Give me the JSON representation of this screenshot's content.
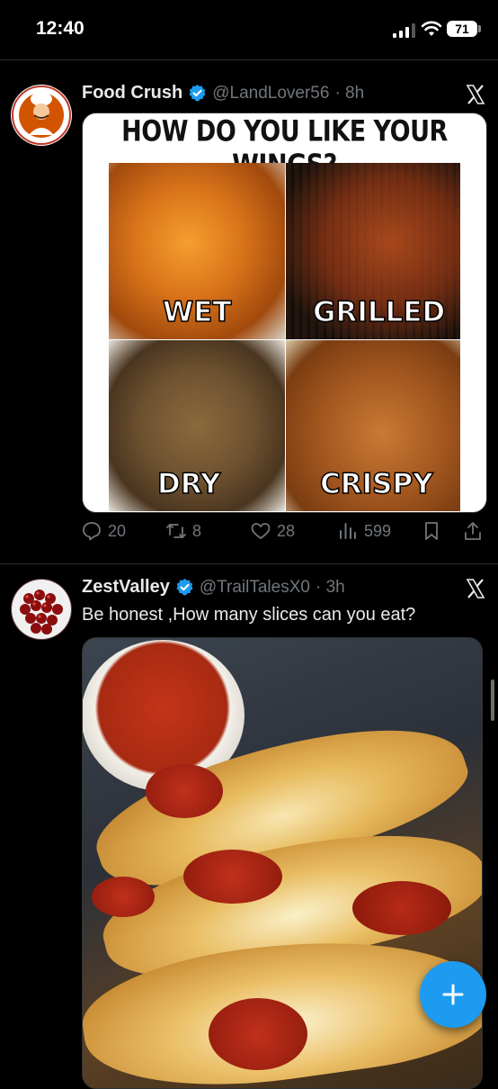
{
  "status": {
    "time": "12:40",
    "battery": "71"
  },
  "tweets": [
    {
      "display_name": "Food Crush",
      "handle": "@LandLover56",
      "time": "· 8h",
      "media": {
        "title": "HOW DO YOU LIKE YOUR WINGS?",
        "quadrants": [
          "WET",
          "GRILLED",
          "DRY",
          "CRISPY"
        ]
      },
      "stats": {
        "replies": "20",
        "reposts": "8",
        "likes": "28",
        "views": "599"
      }
    },
    {
      "display_name": "ZestValley",
      "handle": "@TrailTalesX0",
      "time": "· 3h",
      "text": "Be honest ,How many slices can you eat?"
    }
  ],
  "icons": {
    "verified": "verified-badge-icon",
    "x": "x-logo-icon",
    "reply": "reply-icon",
    "repost": "repost-icon",
    "like": "heart-icon",
    "views": "views-icon",
    "bookmark": "bookmark-icon",
    "share": "share-icon",
    "compose": "plus-icon"
  },
  "colors": {
    "accent": "#1d9bf0",
    "muted": "#71767b",
    "text": "#e7e9ea"
  }
}
